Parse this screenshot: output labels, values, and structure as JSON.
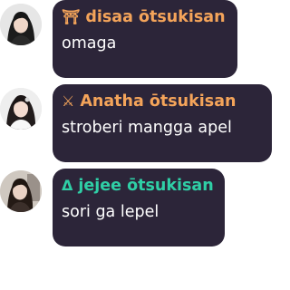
{
  "messages": [
    {
      "name": "disaa ōtsukisan",
      "name_color": "#f4a45a",
      "badge_icon": "badge-icon",
      "badge_glyph": "⛩",
      "text": "omaga"
    },
    {
      "name": "Anatha ōtsukisan",
      "name_color": "#f4a45a",
      "badge_icon": "swords-icon",
      "badge_glyph": "⚔",
      "text": "stroberi mangga apel"
    },
    {
      "name": "jejee ōtsukisan",
      "name_color": "#2fcfa6",
      "badge_icon": "delta-icon",
      "badge_glyph": "Δ",
      "text": "sori ga lepel"
    }
  ],
  "colors": {
    "bubble_bg": "#2c2539",
    "message_text": "#ffffff",
    "page_bg": "#ffffff"
  }
}
